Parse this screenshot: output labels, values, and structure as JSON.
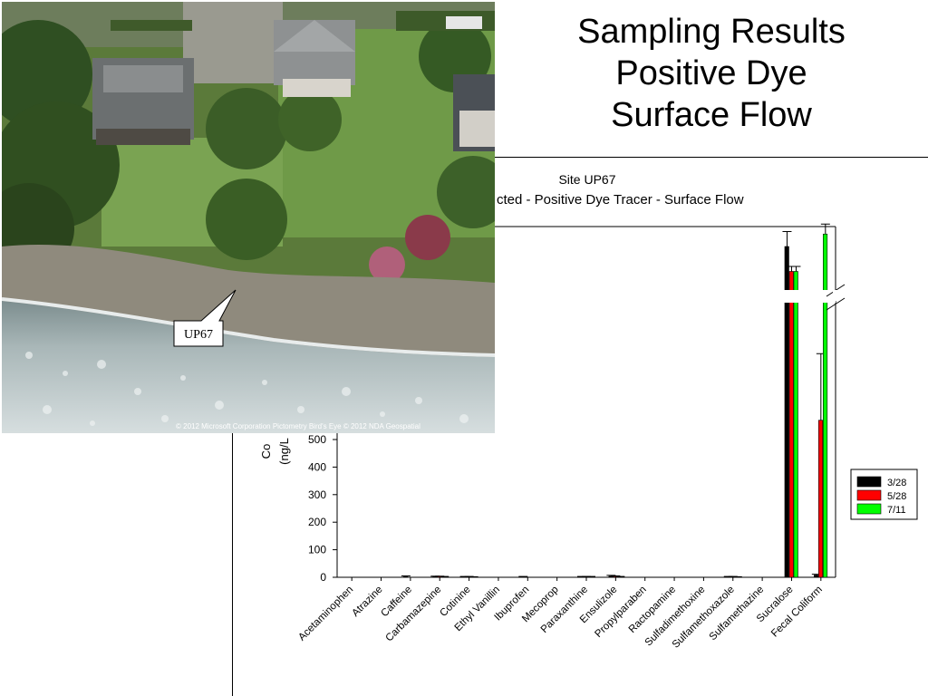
{
  "slide": {
    "title_lines": [
      "Sampling Results",
      "Positive Dye",
      "Surface Flow"
    ]
  },
  "photo": {
    "callout_label": "UP67",
    "credit": "© 2012 Microsoft Corporation   Pictometry Bird's Eye © 2012 NDA Geospatial"
  },
  "chart_data": {
    "type": "bar",
    "title_line1": "Site UP67",
    "title_line2_visible": "cted - Positive Dye Tracer - Surface Flow",
    "ylabel_visible": [
      "Co",
      "(ng/L"
    ],
    "ylim_lower": [
      0,
      650
    ],
    "y_ticks": [
      "0",
      "100",
      "200",
      "300",
      "400",
      "500"
    ],
    "axis_break": true,
    "categories": [
      "Acetaminophen",
      "Atrazine",
      "Caffeine",
      "Carbamazepine",
      "Cotinine",
      "Ethyl Vanillin",
      "Ibuprofen",
      "Mecoprop",
      "Paraxanthine",
      "Ensulizole",
      "Propylparaben",
      "Ractopamine",
      "Sulfadimethoxine",
      "Sulfamethoxazole",
      "Sulfamethazine",
      "Sucralose",
      "Fecal Coliform"
    ],
    "series": [
      {
        "name": "3/28",
        "color": "#000000",
        "values": [
          0,
          0,
          2,
          3,
          2,
          0,
          1,
          0,
          2,
          4,
          0,
          0,
          0,
          2,
          0,
          1100,
          8
        ],
        "errors": [
          0,
          0,
          3,
          1,
          1,
          0,
          2,
          0,
          1,
          3,
          0,
          0,
          0,
          1,
          0,
          60,
          3
        ]
      },
      {
        "name": "5/28",
        "color": "#ff0000",
        "values": [
          0,
          0,
          0,
          3,
          2,
          0,
          0,
          0,
          2,
          3,
          0,
          0,
          0,
          2,
          0,
          1000,
          570
        ],
        "errors": [
          0,
          0,
          0,
          1,
          1,
          0,
          0,
          0,
          1,
          2,
          0,
          0,
          0,
          1,
          0,
          20,
          100
        ]
      },
      {
        "name": "7/11",
        "color": "#00ff00",
        "values": [
          0,
          0,
          0,
          2,
          1,
          0,
          0,
          0,
          2,
          2,
          0,
          0,
          0,
          1,
          0,
          1000,
          1150
        ],
        "errors": [
          0,
          0,
          0,
          1,
          1,
          0,
          0,
          0,
          1,
          1,
          0,
          0,
          0,
          1,
          0,
          20,
          40
        ]
      }
    ],
    "legend_position": "right",
    "grid": false
  }
}
